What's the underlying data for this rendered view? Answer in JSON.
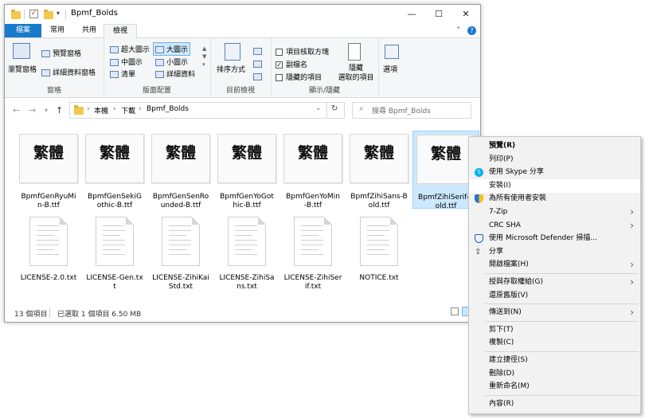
{
  "window": {
    "title": "Bpmf_Bolds",
    "min_label": "—",
    "max_label": "☐",
    "close_label": "✕"
  },
  "ribbon_tabs": [
    "檔案",
    "常用",
    "共用",
    "檢視"
  ],
  "ribbon": {
    "panes": {
      "nav_pane": "瀏覽窗格",
      "preview_pane": "預覽窗格",
      "details_pane": "詳細資料窗格",
      "label": "窗格"
    },
    "layout": {
      "extra_large": "超大圖示",
      "large": "大圖示",
      "medium": "中圖示",
      "small": "小圖示",
      "list": "清單",
      "details": "詳細資料",
      "label": "版面配置"
    },
    "current_view": {
      "sort_by": "排序方式",
      "label": "目前檢視"
    },
    "show_hide": {
      "item_checkboxes": "項目核取方塊",
      "extensions": "副檔名",
      "hidden_items": "隱藏的項目",
      "hide_selected_line1": "隱藏",
      "hide_selected_line2": "選取的項目",
      "label": "顯示/隱藏"
    },
    "options": {
      "label": "選項"
    }
  },
  "address": {
    "breadcrumb": [
      "本機",
      "下載",
      "Bpmf_Bolds"
    ],
    "search_placeholder": "搜尋 Bpmf_Bolds"
  },
  "files": [
    {
      "name": "BpmfGenRyuMin-B.ttf",
      "line1": "BpmfGenRyuMi",
      "line2": "n-B.ttf",
      "type": "font",
      "glyph": "繁體"
    },
    {
      "name": "BpmfGenSekiGothic-B.ttf",
      "line1": "BpmfGenSekiG",
      "line2": "othic-B.ttf",
      "type": "font",
      "glyph": "繁體"
    },
    {
      "name": "BpmfGenSenRounded-B.ttf",
      "line1": "BpmfGenSenRo",
      "line2": "unded-B.ttf",
      "type": "font",
      "glyph": "繁體"
    },
    {
      "name": "BpmfGenYoGothic-B.ttf",
      "line1": "BpmfGenYoGot",
      "line2": "hic-B.ttf",
      "type": "font",
      "glyph": "繁體"
    },
    {
      "name": "BpmfGenYoMin-B.ttf",
      "line1": "BpmfGenYoMin",
      "line2": "-B.ttf",
      "type": "font",
      "glyph": "繁體"
    },
    {
      "name": "BpmfZihiSans-Bold.ttf",
      "line1": "BpmfZihiSans-B",
      "line2": "old.ttf",
      "type": "font",
      "glyph": "繁體"
    },
    {
      "name": "BpmfZihiSerif-Bold.ttf",
      "line1": "BpmfZihiSerif-B",
      "line2": "old.ttf",
      "type": "font",
      "glyph": "繁體",
      "selected": true
    },
    {
      "name": "LICENSE-2.0.txt",
      "line1": "LICENSE-2.0.txt",
      "line2": "",
      "type": "txt"
    },
    {
      "name": "LICENSE-Gen.txt",
      "line1": "LICENSE-Gen.tx",
      "line2": "t",
      "type": "txt"
    },
    {
      "name": "LICENSE-ZihiKaiStd.txt",
      "line1": "LICENSE-ZihiKai",
      "line2": "Std.txt",
      "type": "txt"
    },
    {
      "name": "LICENSE-ZihiSans.txt",
      "line1": "LICENSE-ZihiSa",
      "line2": "ns.txt",
      "type": "txt"
    },
    {
      "name": "LICENSE-ZihiSerif.txt",
      "line1": "LICENSE-ZihiSer",
      "line2": "if.txt",
      "type": "txt"
    },
    {
      "name": "NOTICE.txt",
      "line1": "NOTICE.txt",
      "line2": "",
      "type": "txt"
    }
  ],
  "status": {
    "item_count": "13 個項目",
    "selection": "已選取 1 個項目  6.50 MB"
  },
  "context_menu": [
    {
      "label": "預覽(R)",
      "bold": true
    },
    {
      "label": "列印(P)"
    },
    {
      "label": "使用 Skype 分享",
      "icon": "skype-icon"
    },
    {
      "label": "安裝(I)",
      "hover": true
    },
    {
      "label": "為所有使用者安裝",
      "icon": "shield-icon"
    },
    {
      "label": "7-Zip",
      "sub": true
    },
    {
      "label": "CRC SHA",
      "sub": true
    },
    {
      "label": "使用 Microsoft Defender 掃描...",
      "icon": "defender-icon"
    },
    {
      "label": "分享",
      "icon": "share-icon"
    },
    {
      "label": "開啟檔案(H)",
      "sub": true
    },
    {
      "sep": true
    },
    {
      "label": "授與存取權給(G)",
      "sub": true
    },
    {
      "label": "還原舊版(V)"
    },
    {
      "sep": true
    },
    {
      "label": "傳送到(N)",
      "sub": true
    },
    {
      "sep": true
    },
    {
      "label": "剪下(T)"
    },
    {
      "label": "複製(C)"
    },
    {
      "sep": true
    },
    {
      "label": "建立捷徑(S)"
    },
    {
      "label": "刪除(D)"
    },
    {
      "label": "重新命名(M)"
    },
    {
      "sep": true
    },
    {
      "label": "內容(R)"
    }
  ],
  "colors": {
    "accent": "#1979ca",
    "selection": "#cce8ff"
  }
}
